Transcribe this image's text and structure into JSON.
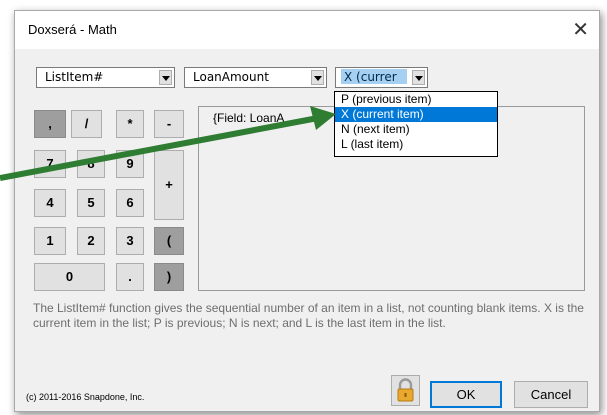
{
  "window": {
    "title": "Doxserá - Math",
    "close_symbol": "✕"
  },
  "toolbar": {
    "function_combo": "ListItem#",
    "field_combo": "LoanAmount",
    "item_combo": "X (currer"
  },
  "keypad": {
    "row1": [
      ",",
      "/",
      "*",
      "-"
    ],
    "row2": [
      "7",
      "8",
      "9"
    ],
    "plus": "+",
    "row3": [
      "4",
      "5",
      "6"
    ],
    "row4": [
      "1",
      "2",
      "3",
      "("
    ],
    "row5": [
      "0",
      ".",
      ")"
    ]
  },
  "editor": {
    "text": "{Field: LoanA"
  },
  "dropdown": {
    "options": [
      {
        "label": "P (previous item)",
        "selected": false
      },
      {
        "label": "X (current item)",
        "selected": true
      },
      {
        "label": "N (next item)",
        "selected": false
      },
      {
        "label": "L (last item)",
        "selected": false
      }
    ]
  },
  "description": "The ListItem# function gives the sequential number of an item in a list, not counting blank items.  X is the current item in the list; P is previous; N is next; and L is the last item in the list.",
  "footer": {
    "copyright": "(c) 2011-2016 Snapdone, Inc.",
    "ok_label": "OK",
    "cancel_label": "Cancel"
  },
  "colors": {
    "accent": "#0078d7",
    "arrow": "#2e7d32",
    "dark_key": "#9e9e9e"
  }
}
